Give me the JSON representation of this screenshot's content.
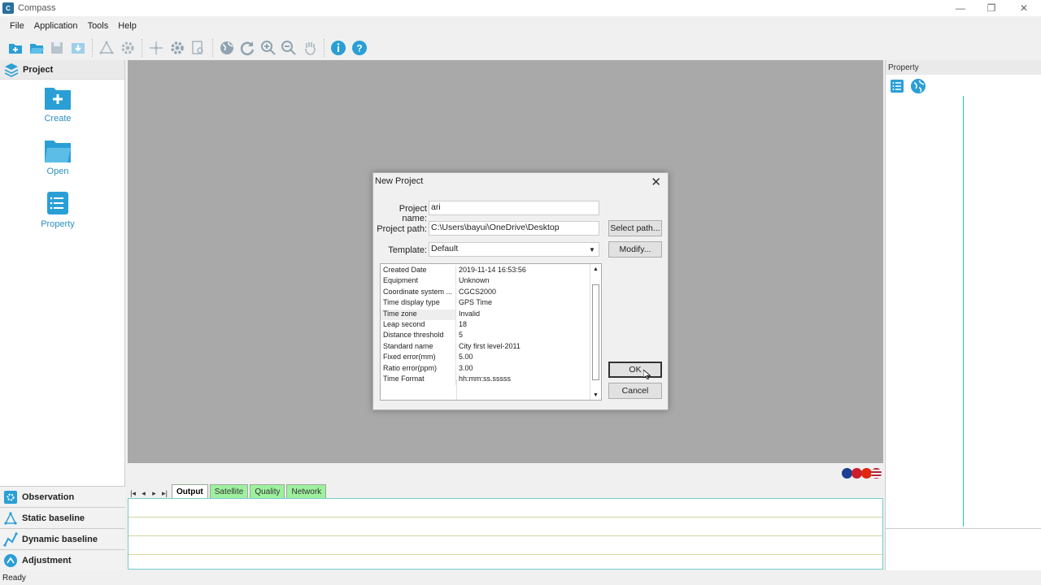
{
  "window": {
    "title": "Compass",
    "app_icon_text": "C"
  },
  "menu": {
    "items": [
      "File",
      "Application",
      "Tools",
      "Help"
    ]
  },
  "toolbar": {
    "icons": [
      "new-project-icon",
      "open-folder-icon",
      "save-icon",
      "import-icon",
      "baseline-icon",
      "settings-icon",
      "move-icon",
      "gear-icon",
      "report-icon",
      "globe-icon",
      "refresh-icon",
      "zoom-in-icon",
      "zoom-out-icon",
      "pan-hand-icon",
      "info-icon",
      "help-icon"
    ]
  },
  "left_panel": {
    "header": "Project",
    "items": [
      {
        "label": "Create",
        "icon": "create-icon"
      },
      {
        "label": "Open",
        "icon": "open-icon"
      },
      {
        "label": "Property",
        "icon": "property-icon"
      }
    ],
    "sections": [
      {
        "label": "Observation",
        "icon": "observation-icon"
      },
      {
        "label": "Static baseline",
        "icon": "static-baseline-icon"
      },
      {
        "label": "Dynamic baseline",
        "icon": "dynamic-baseline-icon"
      },
      {
        "label": "Adjustment",
        "icon": "adjustment-icon"
      }
    ]
  },
  "output": {
    "tabs": [
      "Output",
      "Satellite",
      "Quality",
      "Network"
    ],
    "active_tab": "Output",
    "nav": [
      "|◂",
      "◂",
      "▸",
      "▸|"
    ]
  },
  "right_panel": {
    "header": "Property"
  },
  "status": {
    "text": "Ready"
  },
  "dialog": {
    "title": "New Project",
    "project_name_label": "Project name:",
    "project_name": "ari",
    "project_path_label": "Project path:",
    "project_path": "C:\\Users\\bayui\\OneDrive\\Desktop",
    "select_path_label": "Select path...",
    "template_label": "Template:",
    "template": "Default",
    "modify_label": "Modify...",
    "ok_label": "OK",
    "cancel_label": "Cancel",
    "properties": [
      {
        "key": "Created Date",
        "value": "2019-11-14  16:53:56"
      },
      {
        "key": "Equipment",
        "value": "Unknown"
      },
      {
        "key": "Coordinate system ...",
        "value": "CGCS2000"
      },
      {
        "key": "Time display type",
        "value": "GPS Time"
      },
      {
        "key": "Time zone",
        "value": "Invalid"
      },
      {
        "key": "Leap second",
        "value": "18"
      },
      {
        "key": "Distance threshold",
        "value": "5"
      },
      {
        "key": "Standard name",
        "value": "City first level-2011"
      },
      {
        "key": "Fixed error(mm)",
        "value": "5.00"
      },
      {
        "key": "Ratio error(ppm)",
        "value": "3.00"
      },
      {
        "key": "Time Format",
        "value": "hh:mm:ss.sssss"
      }
    ]
  },
  "colors": {
    "accent": "#2a9fd6",
    "canvas": "#a9a9a9",
    "tab_green": "#9ef09e"
  }
}
